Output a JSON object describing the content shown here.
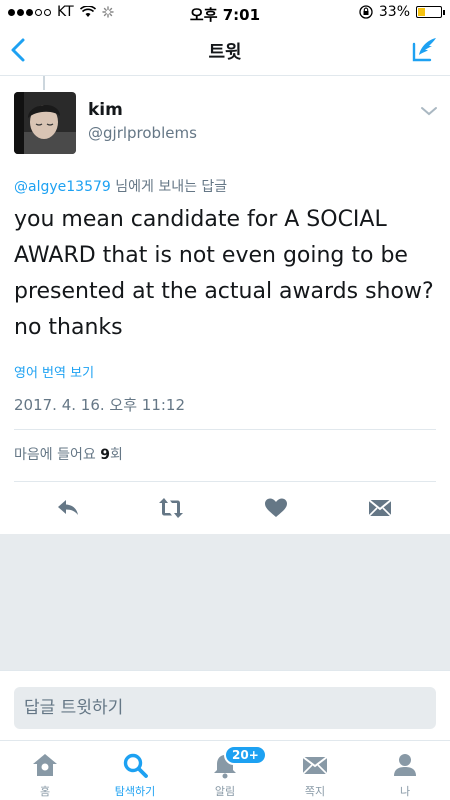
{
  "status_bar": {
    "carrier": "KT",
    "time": "오후 7:01",
    "battery": "33%",
    "battery_level": 0.33
  },
  "nav": {
    "title": "트윗"
  },
  "tweet": {
    "user_name": "kim",
    "user_handle": "@gjrlproblems",
    "reply_mention": "@algye13579",
    "reply_suffix": " 님에게 보내는 답글",
    "text": "you mean candidate for A SOCIAL AWARD that is not even going to be presented at the actual awards show? no thanks",
    "translate_label": "영어 번역 보기",
    "timestamp": "2017. 4. 16. 오후 11:12",
    "likes_label": "마음에 들어요",
    "likes_count": "9",
    "likes_suffix": "회"
  },
  "reply_bar": {
    "placeholder": "답글 트윗하기"
  },
  "tabs": [
    {
      "label": "홈",
      "icon": "home-icon"
    },
    {
      "label": "탐색하기",
      "icon": "search-icon"
    },
    {
      "label": "알림",
      "icon": "bell-icon",
      "badge": "20+"
    },
    {
      "label": "쪽지",
      "icon": "mail-icon"
    },
    {
      "label": "나",
      "icon": "person-icon"
    }
  ],
  "colors": {
    "accent": "#1da1f2",
    "text": "#14171a",
    "muted": "#657786",
    "icon": "#8899a6",
    "background_grey": "#e7ebee",
    "battery_fill": "#f5c211"
  }
}
